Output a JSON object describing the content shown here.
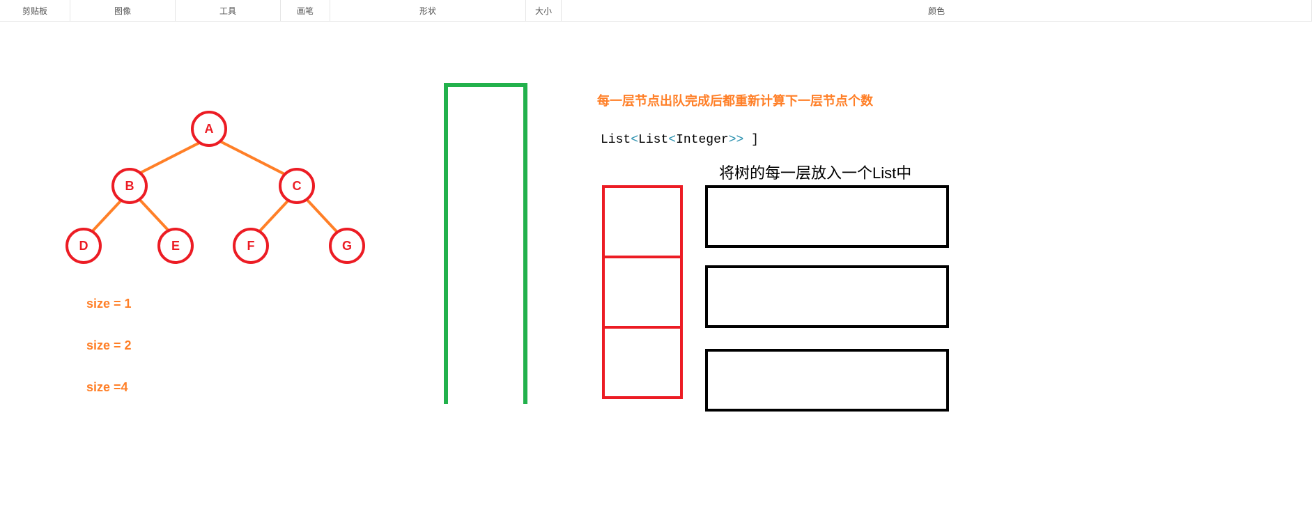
{
  "toolbar": {
    "clipboard": "剪贴板",
    "image": "图像",
    "tool": "工具",
    "brush": "画笔",
    "shape": "形状",
    "size": "大小",
    "color": "颜色"
  },
  "tree": {
    "nodes": {
      "a": "A",
      "b": "B",
      "c": "C",
      "d": "D",
      "e": "E",
      "f": "F",
      "g": "G"
    }
  },
  "sizes": {
    "s1": "size = 1",
    "s2": "size = 2",
    "s4": "size =4"
  },
  "heading_orange": "每一层节点出队完成后都重新计算下一层节点个数",
  "code": {
    "p1": "List",
    "lt1": "<",
    "p2": "List",
    "lt2": "<",
    "p3": "Integer",
    "gt": ">> ",
    "rb": "]"
  },
  "heading_black": "将树的每一层放入一个List中"
}
